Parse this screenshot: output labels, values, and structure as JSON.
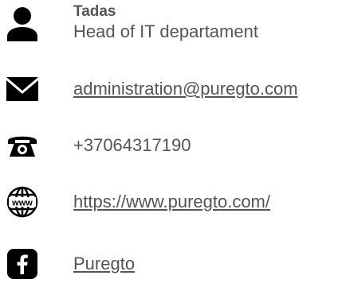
{
  "contact": {
    "name": "Tadas",
    "title": "Head of IT departament",
    "email": "administration@puregto.com",
    "phone": "+37064317190",
    "website": "https://www.puregto.com/",
    "facebook": "Puregto"
  },
  "icons": {
    "person": "person-icon",
    "email": "envelope-icon",
    "phone": "telephone-icon",
    "website": "www-globe-icon",
    "facebook": "facebook-icon"
  },
  "colors": {
    "icon": "#000000",
    "text": "#555555"
  }
}
